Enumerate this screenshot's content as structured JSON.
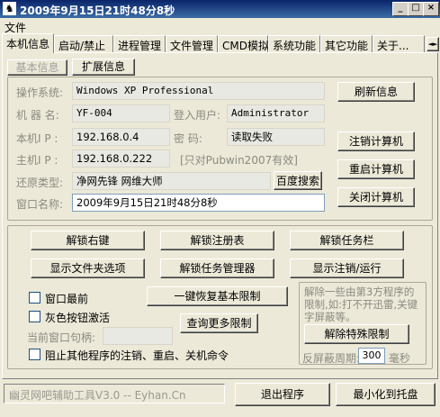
{
  "window": {
    "title": "2009年9月15日21时48分8秒",
    "minimize": "_",
    "maximize": "□",
    "close": "×",
    "app_icon": "person-icon"
  },
  "menu": {
    "file": "文件"
  },
  "tabs": [
    "本机信息",
    "启动/禁止",
    "进程管理",
    "文件管理",
    "CMD模拟",
    "系统功能",
    "其它功能",
    "关于..."
  ],
  "tab_scroll": "◄►",
  "subtabs": {
    "basic": "基本信息",
    "extended": "扩展信息"
  },
  "info": {
    "os_label": "操作系统:",
    "os_value": "Windows XP Professional",
    "machine_label": "机 器 名:",
    "machine_value": "YF-004",
    "user_label": "登入用户:",
    "user_value": "Administrator",
    "ip_label": "本机I P :",
    "ip_value": "192.168.0.4",
    "pwd_label": "密    码:",
    "pwd_value": "读取失败",
    "host_label": "主机I P :",
    "host_value": "192.168.0.222",
    "host_note": "[只对Pubwin2007有效]",
    "restore_label": "还原类型:",
    "restore_value": "净网先锋  网维大师",
    "window_label": "窗口名称:",
    "window_value": "2009年9月15日21时48分8秒"
  },
  "buttons": {
    "refresh": "刷新信息",
    "baidu": "百度搜索",
    "logoff": "注销计算机",
    "restart": "重启计算机",
    "shutdown": "关闭计算机",
    "unlock_rightclick": "解锁右键",
    "unlock_registry": "解锁注册表",
    "unlock_taskbar": "解锁任务栏",
    "show_folder_options": "显示文件夹选项",
    "unlock_taskmgr": "解锁任务管理器",
    "show_logoff_run": "显示注销/运行",
    "restore_basic": "一键恢复基本限制",
    "query_more": "查询更多限制",
    "unlock_special": "解除特殊限制",
    "exit": "退出程序",
    "minimize_tray": "最小化到托盘"
  },
  "options": {
    "topmost": "窗口最前",
    "activate_gray": "灰色按钮激活",
    "handle_label": "当前窗口句柄:",
    "handle_value": "",
    "block_commands": "阻止其他程序的注销、重启、关机命令"
  },
  "special": {
    "desc": "解除一些由第3方程序的限制,如:打不开迅雷,关键字屏蔽等。",
    "period_label": "反屏蔽周期:",
    "period_value": "300",
    "period_unit": "毫秒"
  },
  "footer": {
    "credit": "幽灵网吧辅助工具V3.0 -- Eyhan.Cn"
  }
}
